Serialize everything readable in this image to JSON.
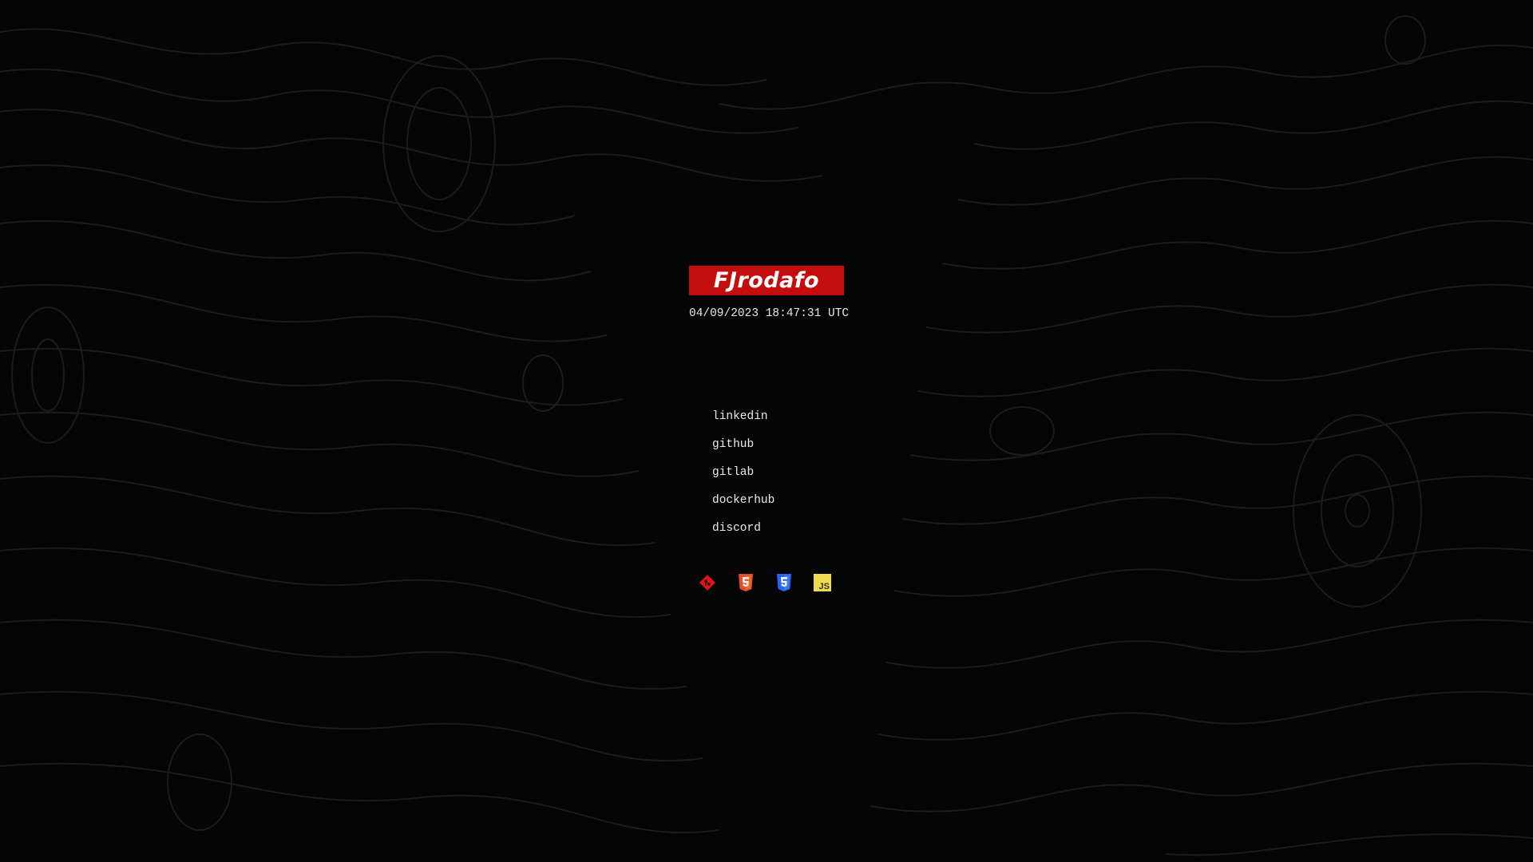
{
  "brand": {
    "name": "FJrodafo"
  },
  "clock": {
    "text": "04/09/2023 18:47:31 UTC"
  },
  "links": [
    {
      "label": "linkedin"
    },
    {
      "label": "github"
    },
    {
      "label": "gitlab"
    },
    {
      "label": "dockerhub"
    },
    {
      "label": "discord"
    }
  ],
  "tech_icons": [
    {
      "name": "git-icon",
      "color": "#e01515"
    },
    {
      "name": "html5-icon",
      "color": "#e44d26"
    },
    {
      "name": "css3-icon",
      "color": "#2965f1"
    },
    {
      "name": "javascript-icon",
      "color": "#f0db4f",
      "text": "JS"
    }
  ],
  "colors": {
    "background": "#050505",
    "accent": "#c40d0d",
    "contour": "#1a1a1a"
  }
}
